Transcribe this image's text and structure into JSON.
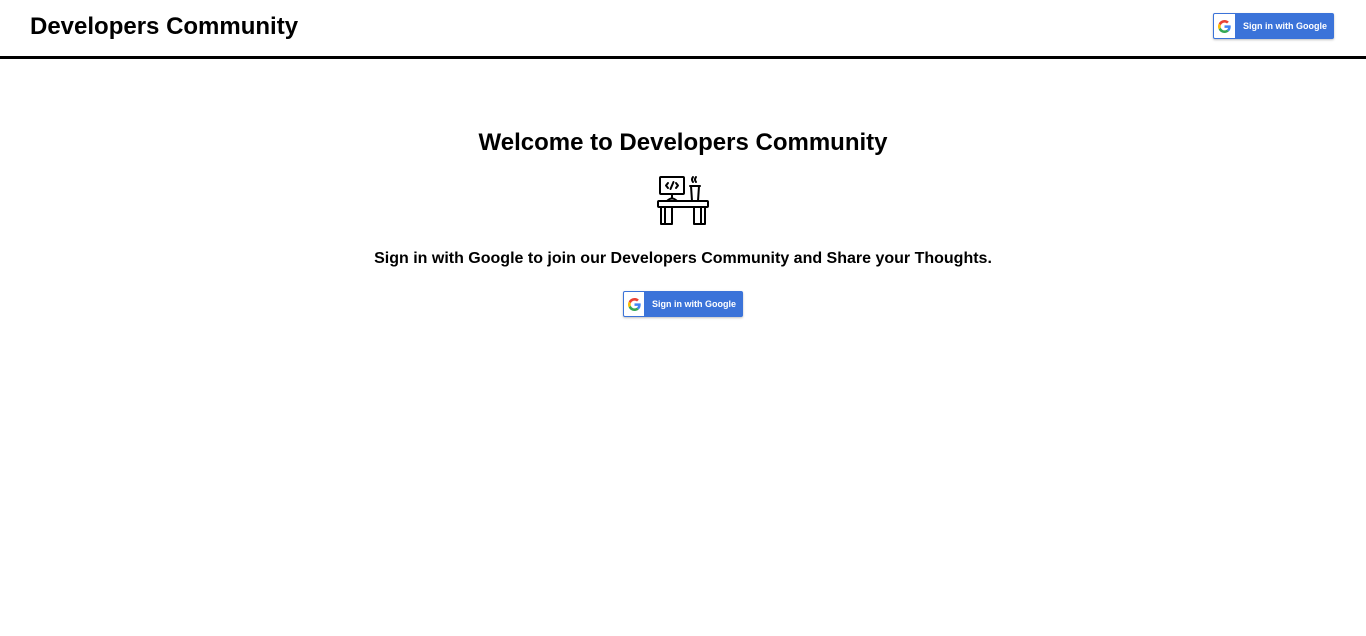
{
  "header": {
    "title": "Developers Community",
    "signin_label": "Sign in with Google"
  },
  "main": {
    "welcome": "Welcome to Developers Community",
    "illustration_icon": "developer-desk-icon",
    "subtitle": "Sign in with Google to join our Developers Community and Share your Thoughts.",
    "signin_label": "Sign in with Google"
  },
  "colors": {
    "google_button_blue": "#3b73d9",
    "header_border": "#000000"
  }
}
